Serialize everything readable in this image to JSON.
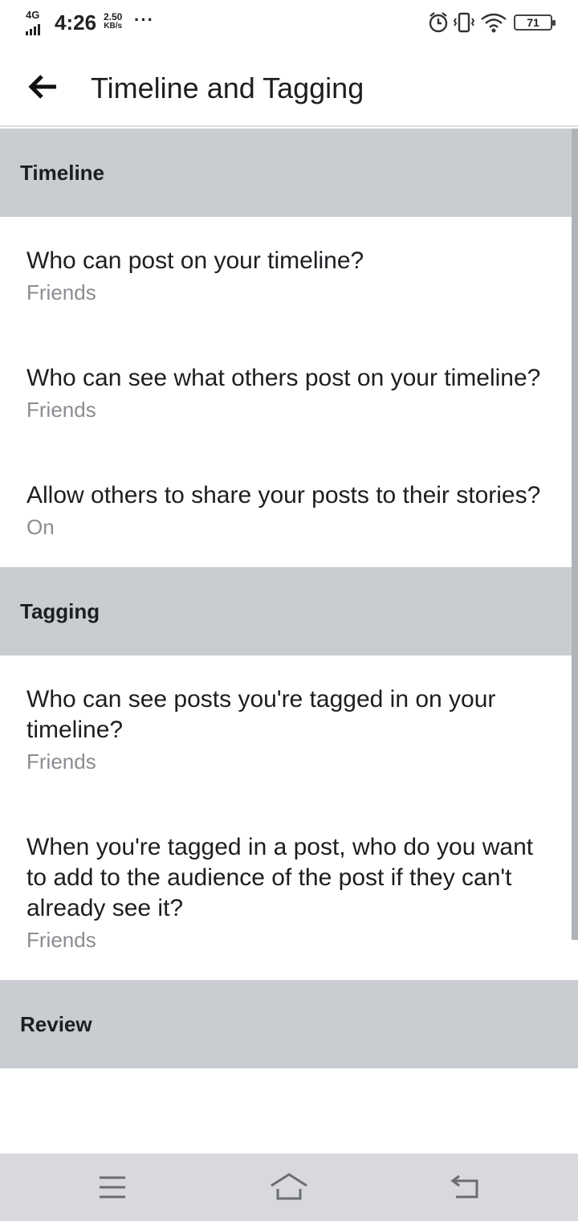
{
  "status_bar": {
    "network": "4G",
    "time": "4:26",
    "speed_value": "2.50",
    "speed_unit": "KB/s",
    "more": "···",
    "battery": "71",
    "icons": [
      "alarm-icon",
      "vibrate-icon",
      "wifi-icon",
      "battery-icon"
    ]
  },
  "app_bar": {
    "title": "Timeline and Tagging",
    "back_icon": "arrow-left-icon"
  },
  "sections": {
    "timeline": {
      "header": "Timeline",
      "items": [
        {
          "question": "Who can post on your timeline?",
          "value": "Friends"
        },
        {
          "question": "Who can see what others post on your timeline?",
          "value": "Friends"
        },
        {
          "question": "Allow others to share your posts to their stories?",
          "value": "On"
        }
      ]
    },
    "tagging": {
      "header": "Tagging",
      "items": [
        {
          "question": "Who can see posts you're tagged in on your timeline?",
          "value": "Friends"
        },
        {
          "question": "When you're tagged in a post, who do you want to add to the audience of the post if they can't already see it?",
          "value": "Friends"
        }
      ]
    },
    "review": {
      "header": "Review"
    }
  },
  "nav_bar": {
    "icons": [
      "menu-icon",
      "home-icon",
      "back-icon"
    ]
  },
  "colors": {
    "section_bg": "#c9ccd1",
    "text_primary": "#1c1e21",
    "text_secondary": "#8a8d91",
    "nav_bg": "#d8d9dc"
  }
}
